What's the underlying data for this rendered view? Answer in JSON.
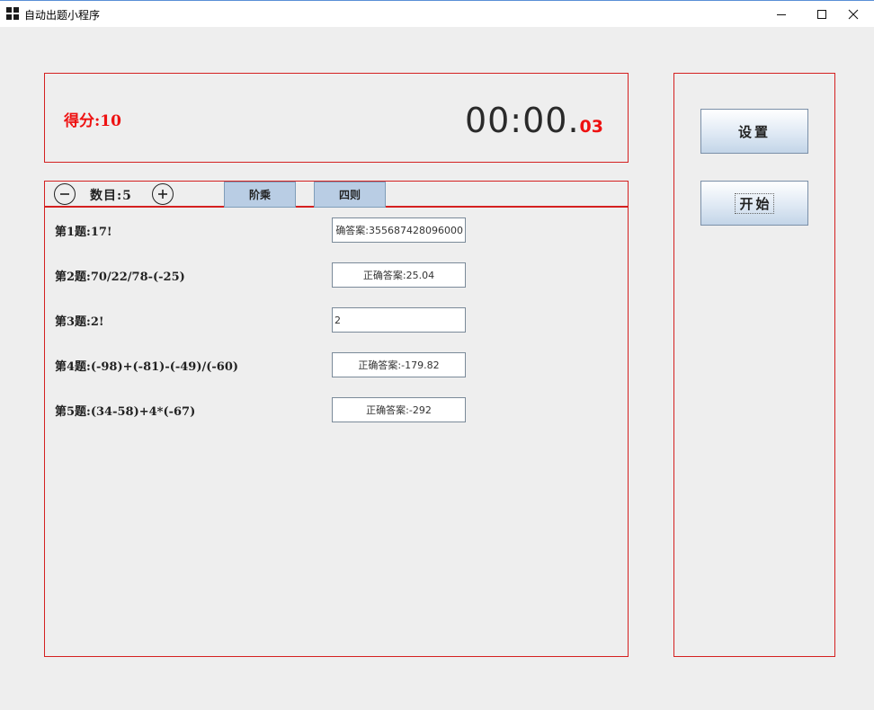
{
  "window": {
    "title": "自动出题小程序"
  },
  "header": {
    "score_text": "得分:10",
    "timer_main": "00:00.",
    "timer_ms": "03"
  },
  "toolbar": {
    "count_text": "数目:5",
    "tabs": [
      {
        "label": "阶乘"
      },
      {
        "label": "四则"
      }
    ]
  },
  "questions": [
    {
      "label": "第1题:17!",
      "answer": "确答案:355687428096000"
    },
    {
      "label": "第2题:70/22/78-(-25)",
      "answer": "正确答案:25.04"
    },
    {
      "label": "第3题:2!",
      "answer": "2"
    },
    {
      "label": "第4题:(-98)+(-81)-(-49)/(-60)",
      "answer": "正确答案:-179.82"
    },
    {
      "label": "第5题:(34-58)+4*(-67)",
      "answer": "正确答案:-292"
    }
  ],
  "side": {
    "settings_label": "设置",
    "start_label": "开始"
  },
  "colors": {
    "accent_red": "#ee1111",
    "border_red": "#d42020",
    "tab_blue": "#b9cde4"
  }
}
